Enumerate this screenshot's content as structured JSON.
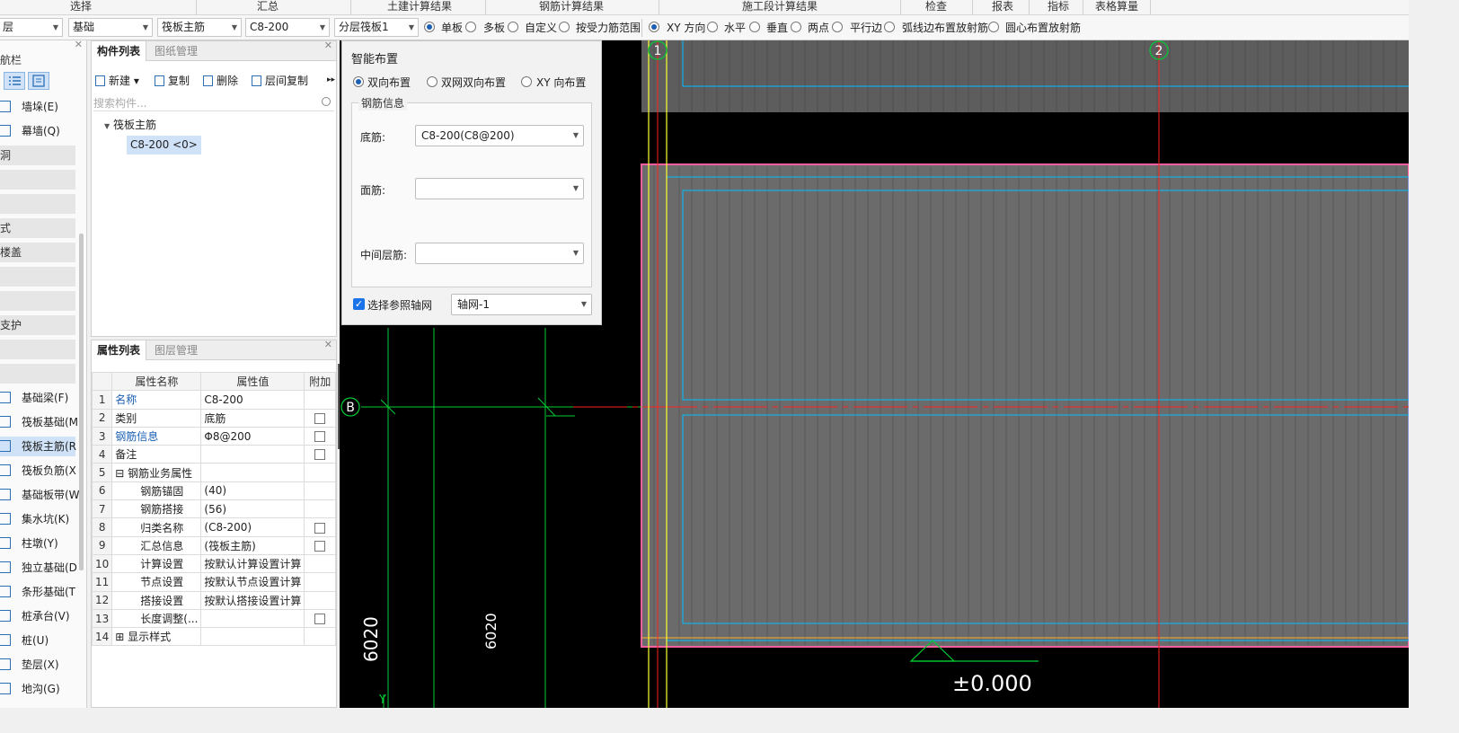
{
  "ribbon": {
    "groups": [
      "选择",
      "汇总",
      "土建计算结果",
      "钢筋计算结果",
      "施工段计算结果",
      "检查",
      "报表",
      "指标",
      "表格算量"
    ]
  },
  "toolbar": {
    "floor_dd": "层",
    "category_dd": "基础",
    "component_type_dd": "筏板主筋",
    "component_dd": "C8-200",
    "layer_dd": "分层筏板1",
    "radios": [
      {
        "label": "单板",
        "checked": true
      },
      {
        "label": "多板",
        "checked": false
      },
      {
        "label": "自定义",
        "checked": false
      },
      {
        "label": "按受力筋范围",
        "checked": false
      },
      {
        "label": "XY 方向",
        "checked": true
      },
      {
        "label": "水平",
        "checked": false
      },
      {
        "label": "垂直",
        "checked": false
      },
      {
        "label": "两点",
        "checked": false
      },
      {
        "label": "平行边",
        "checked": false
      },
      {
        "label": "弧线边布置放射筋",
        "checked": false
      },
      {
        "label": "圆心布置放射筋",
        "checked": false
      }
    ]
  },
  "nav": {
    "title": "航栏",
    "items": [
      {
        "label": "墙垛(E)",
        "kind": "item"
      },
      {
        "label": "幕墙(Q)",
        "kind": "item"
      },
      {
        "label": "洞",
        "kind": "cat"
      },
      {
        "label": "",
        "kind": "cat"
      },
      {
        "label": "",
        "kind": "cat"
      },
      {
        "label": "式",
        "kind": "cat"
      },
      {
        "label": "楼盖",
        "kind": "cat"
      },
      {
        "label": "",
        "kind": "cat"
      },
      {
        "label": "",
        "kind": "cat"
      },
      {
        "label": "支护",
        "kind": "cat"
      },
      {
        "label": "",
        "kind": "cat"
      },
      {
        "label": "",
        "kind": "cat"
      },
      {
        "label": "基础梁(F)",
        "kind": "item"
      },
      {
        "label": "筏板基础(M",
        "kind": "item"
      },
      {
        "label": "筏板主筋(R",
        "kind": "item",
        "selected": true
      },
      {
        "label": "筏板负筋(X",
        "kind": "item"
      },
      {
        "label": "基础板带(W",
        "kind": "item"
      },
      {
        "label": "集水坑(K)",
        "kind": "item"
      },
      {
        "label": "柱墩(Y)",
        "kind": "item"
      },
      {
        "label": "独立基础(D",
        "kind": "item"
      },
      {
        "label": "条形基础(T",
        "kind": "item"
      },
      {
        "label": "桩承台(V)",
        "kind": "item"
      },
      {
        "label": "桩(U)",
        "kind": "item"
      },
      {
        "label": "垫层(X)",
        "kind": "item"
      },
      {
        "label": "地沟(G)",
        "kind": "item"
      }
    ]
  },
  "complist": {
    "tabs": [
      "构件列表",
      "图纸管理"
    ],
    "toolbar": [
      "新建",
      "复制",
      "删除",
      "层间复制"
    ],
    "search_placeholder": "搜索构件...",
    "tree_root": "筏板主筋",
    "tree_item": "C8-200 <0>"
  },
  "props": {
    "tabs": [
      "属性列表",
      "图层管理"
    ],
    "headers": [
      "属性名称",
      "属性值",
      "附加"
    ],
    "rows": [
      {
        "n": "1",
        "name": "名称",
        "value": "C8-200",
        "blue": true,
        "cb": false
      },
      {
        "n": "2",
        "name": "类别",
        "value": "底筋",
        "blue": false,
        "cb": true
      },
      {
        "n": "3",
        "name": "钢筋信息",
        "value": "Φ8@200",
        "blue": true,
        "cb": true
      },
      {
        "n": "4",
        "name": "备注",
        "value": "",
        "blue": false,
        "cb": true
      },
      {
        "n": "5",
        "name": "钢筋业务属性",
        "value": "",
        "blue": false,
        "cb": false
      },
      {
        "n": "6",
        "name": "钢筋锚固",
        "value": "(40)",
        "blue": false,
        "cb": false
      },
      {
        "n": "7",
        "name": "钢筋搭接",
        "value": "(56)",
        "blue": false,
        "cb": false
      },
      {
        "n": "8",
        "name": "归类名称",
        "value": "(C8-200)",
        "blue": false,
        "cb": true
      },
      {
        "n": "9",
        "name": "汇总信息",
        "value": "(筏板主筋)",
        "blue": false,
        "cb": true
      },
      {
        "n": "10",
        "name": "计算设置",
        "value": "按默认计算设置计算",
        "blue": false,
        "cb": false
      },
      {
        "n": "11",
        "name": "节点设置",
        "value": "按默认节点设置计算",
        "blue": false,
        "cb": false
      },
      {
        "n": "12",
        "name": "搭接设置",
        "value": "按默认搭接设置计算",
        "blue": false,
        "cb": false
      },
      {
        "n": "13",
        "name": "长度调整(...",
        "value": "",
        "blue": false,
        "cb": true
      },
      {
        "n": "14",
        "name": "显示样式",
        "value": "",
        "blue": false,
        "cb": false
      }
    ]
  },
  "dialog": {
    "title": "智能布置",
    "mode_options": [
      {
        "label": "双向布置",
        "checked": true
      },
      {
        "label": "双网双向布置",
        "checked": false
      },
      {
        "label": "XY 向布置",
        "checked": false
      }
    ],
    "group_title": "钢筋信息",
    "bottom_label": "底筋:",
    "bottom_value": "C8-200(C8@200)",
    "top_label": "面筋:",
    "top_value": "",
    "middle_label": "中间层筋:",
    "middle_value": "",
    "ref_axis_label": "选择参照轴网",
    "ref_axis_checked": true,
    "ref_axis_value": "轴网-1"
  },
  "canvas": {
    "axis_labels": [
      "1",
      "2",
      "B"
    ],
    "dim_left": "6020",
    "dim_mid": "6020",
    "elevation": "±0.000",
    "y_axis": "Y",
    "colors": {
      "bg": "#000000",
      "slab": "#6b6b6b",
      "cyan": "#00bfff",
      "red": "#ff2020",
      "green": "#00cc33",
      "yellow": "#ffff33",
      "pink": "#ff5fa0"
    }
  }
}
